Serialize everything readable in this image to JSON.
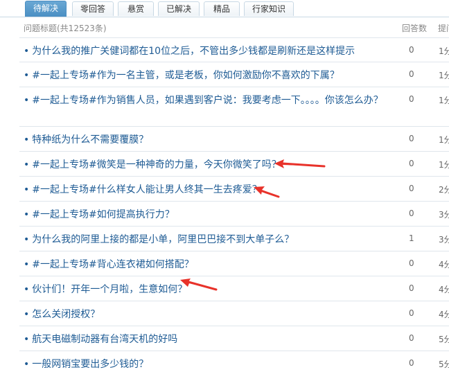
{
  "tabs": [
    {
      "label": "待解决",
      "active": true
    },
    {
      "label": "零回答",
      "active": false
    },
    {
      "label": "悬赏",
      "active": false
    },
    {
      "label": "已解决",
      "active": false
    },
    {
      "label": "精品",
      "active": false
    },
    {
      "label": "行家知识",
      "active": false
    }
  ],
  "table": {
    "header_title": "问题标题(共12523条)",
    "header_count": "回答数",
    "header_time": "提问"
  },
  "rows": [
    {
      "title": "为什么我的推广关健词都在10位之后，不管出多少钱都是刷新还是这样提示",
      "count": "0",
      "time": "1分"
    },
    {
      "title": "#一起上专场#作为一名主管，或是老板，你如何激励你不喜欢的下属？",
      "count": "0",
      "time": "1分"
    },
    {
      "title": "#一起上专场#作为销售人员，如果遇到客户说：我要考虑一下。。。。你该怎么办？",
      "count": "0",
      "time": "1分"
    },
    {
      "title": "特种纸为什么不需要覆膜？",
      "count": "0",
      "time": "1分"
    },
    {
      "title": "#一起上专场#微笑是一种神奇的力量，今天你微笑了吗？",
      "count": "0",
      "time": "1分"
    },
    {
      "title": "#一起上专场#什么样女人能让男人终其一生去疼爱？",
      "count": "0",
      "time": "2分"
    },
    {
      "title": "#一起上专场#如何提高执行力？",
      "count": "0",
      "time": "3分"
    },
    {
      "title": "为什么我的阿里上接的都是小单，阿里巴巴接不到大单子么？",
      "count": "1",
      "time": "3分"
    },
    {
      "title": "#一起上专场#背心连衣裙如何搭配？",
      "count": "0",
      "time": "4分"
    },
    {
      "title": "伙计们！开年一个月啦，生意如何？",
      "count": "0",
      "time": "4分"
    },
    {
      "title": "怎么关闭授权？",
      "count": "0",
      "time": "4分"
    },
    {
      "title": "航天电磁制动器有台湾天机的好吗",
      "count": "0",
      "time": "5分"
    },
    {
      "title": "一般网销宝要出多少钱的？",
      "count": "0",
      "time": "5分"
    }
  ],
  "colors": {
    "link": "#1e5b94",
    "active_tab": "#4b8fc3",
    "arrow": "#e8322a"
  }
}
